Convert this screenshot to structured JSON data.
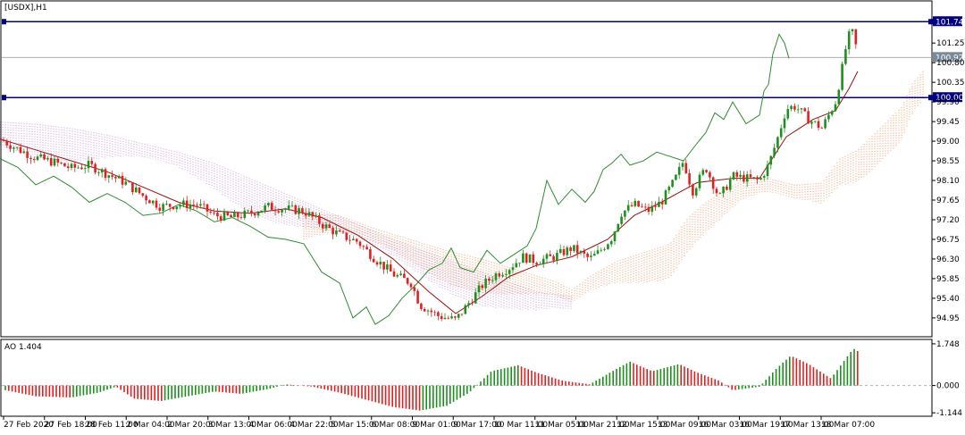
{
  "window_title": "[USDX],H1",
  "indicator_label": "AO 1.404",
  "colors": {
    "bull": "#1e8f1e",
    "bear": "#e02020",
    "ma": "#9a1010",
    "chikou": "#2e8b2e",
    "cloud_bull": "#f0a070",
    "cloud_bear": "#c8a0d8",
    "hline": "#000080",
    "price_tag": "#7a8a99"
  },
  "chart_data": [
    {
      "type": "candlestick",
      "title": "[USDX],H1",
      "ylim": [
        94.62,
        101.95
      ],
      "y_ticks": [
        "101.25",
        "100.80",
        "100.35",
        "99.90",
        "99.45",
        "99.00",
        "98.55",
        "98.10",
        "97.65",
        "97.20",
        "96.75",
        "96.30",
        "95.85",
        "95.40",
        "94.95"
      ],
      "x_ticks": [
        "27 Feb 2020",
        "27 Feb 18:00",
        "28 Feb 11:00",
        "2 Mar 04:00",
        "2 Mar 20:00",
        "3 Mar 13:00",
        "4 Mar 06:00",
        "4 Mar 22:00",
        "5 Mar 15:00",
        "6 Mar 08:00",
        "9 Mar 01:00",
        "9 Mar 17:00",
        "10 Mar 11:00",
        "11 Mar 05:00",
        "11 Mar 21:00",
        "12 Mar 15:00",
        "13 Mar 09:00",
        "16 Mar 03:00",
        "16 Mar 19:00",
        "17 Mar 13:00",
        "18 Mar 07:00"
      ],
      "horizontal_lines": [
        {
          "label": "101.74",
          "value": 101.74
        },
        {
          "label": "100.00",
          "value": 100.0
        }
      ],
      "current_price": {
        "label": "100.92",
        "value": 100.92
      },
      "close_path": [
        [
          0,
          99.05
        ],
        [
          20,
          98.82
        ],
        [
          40,
          98.62
        ],
        [
          60,
          98.52
        ],
        [
          80,
          98.38
        ],
        [
          100,
          98.45
        ],
        [
          120,
          98.25
        ],
        [
          140,
          98.05
        ],
        [
          160,
          97.75
        ],
        [
          180,
          97.5
        ],
        [
          200,
          97.55
        ],
        [
          220,
          97.55
        ],
        [
          240,
          97.3
        ],
        [
          260,
          97.25
        ],
        [
          280,
          97.35
        ],
        [
          300,
          97.5
        ],
        [
          320,
          97.45
        ],
        [
          340,
          97.4
        ],
        [
          360,
          97.1
        ],
        [
          380,
          96.85
        ],
        [
          400,
          96.7
        ],
        [
          420,
          96.3
        ],
        [
          440,
          95.95
        ],
        [
          460,
          95.75
        ],
        [
          470,
          95.25
        ],
        [
          490,
          95.0
        ],
        [
          510,
          94.9
        ],
        [
          525,
          95.3
        ],
        [
          540,
          95.7
        ],
        [
          555,
          95.95
        ],
        [
          570,
          96.1
        ],
        [
          585,
          96.35
        ],
        [
          600,
          96.25
        ],
        [
          620,
          96.35
        ],
        [
          640,
          96.55
        ],
        [
          660,
          96.3
        ],
        [
          670,
          96.45
        ],
        [
          685,
          96.8
        ],
        [
          695,
          97.35
        ],
        [
          710,
          97.55
        ],
        [
          725,
          97.4
        ],
        [
          740,
          97.6
        ],
        [
          755,
          98.1
        ],
        [
          765,
          98.55
        ],
        [
          775,
          97.85
        ],
        [
          790,
          98.4
        ],
        [
          805,
          97.7
        ],
        [
          820,
          98.2
        ],
        [
          835,
          98.15
        ],
        [
          850,
          98.1
        ],
        [
          860,
          98.45
        ],
        [
          870,
          99.05
        ],
        [
          880,
          99.75
        ],
        [
          890,
          99.8
        ],
        [
          905,
          99.5
        ],
        [
          920,
          99.3
        ],
        [
          935,
          99.9
        ],
        [
          942,
          100.6
        ],
        [
          948,
          101.3
        ],
        [
          953,
          101.55
        ],
        [
          957,
          101.25
        ],
        [
          961,
          100.92
        ]
      ],
      "ma_path": [
        [
          0,
          99.05
        ],
        [
          40,
          98.8
        ],
        [
          80,
          98.55
        ],
        [
          120,
          98.3
        ],
        [
          160,
          97.95
        ],
        [
          200,
          97.6
        ],
        [
          240,
          97.4
        ],
        [
          280,
          97.35
        ],
        [
          320,
          97.45
        ],
        [
          360,
          97.25
        ],
        [
          400,
          96.85
        ],
        [
          440,
          96.3
        ],
        [
          480,
          95.55
        ],
        [
          510,
          95.05
        ],
        [
          540,
          95.45
        ],
        [
          570,
          95.9
        ],
        [
          600,
          96.15
        ],
        [
          640,
          96.35
        ],
        [
          680,
          96.75
        ],
        [
          710,
          97.3
        ],
        [
          740,
          97.6
        ],
        [
          780,
          98.05
        ],
        [
          820,
          98.15
        ],
        [
          850,
          98.15
        ],
        [
          880,
          99.1
        ],
        [
          910,
          99.5
        ],
        [
          935,
          99.7
        ],
        [
          950,
          100.2
        ],
        [
          960,
          100.6
        ]
      ],
      "chikou_path": [
        [
          0,
          98.6
        ],
        [
          20,
          98.4
        ],
        [
          40,
          98.0
        ],
        [
          60,
          98.2
        ],
        [
          80,
          97.95
        ],
        [
          100,
          97.6
        ],
        [
          120,
          97.8
        ],
        [
          140,
          97.6
        ],
        [
          160,
          97.3
        ],
        [
          180,
          97.35
        ],
        [
          200,
          97.55
        ],
        [
          220,
          97.4
        ],
        [
          240,
          97.15
        ],
        [
          260,
          97.25
        ],
        [
          280,
          97.05
        ],
        [
          300,
          96.8
        ],
        [
          320,
          96.75
        ],
        [
          340,
          96.65
        ],
        [
          360,
          96.0
        ],
        [
          380,
          95.75
        ],
        [
          395,
          94.95
        ],
        [
          410,
          95.2
        ],
        [
          420,
          94.8
        ],
        [
          435,
          95.0
        ],
        [
          450,
          95.4
        ],
        [
          465,
          95.7
        ],
        [
          480,
          96.05
        ],
        [
          495,
          96.2
        ],
        [
          505,
          96.55
        ],
        [
          515,
          96.1
        ],
        [
          530,
          96.0
        ],
        [
          545,
          96.5
        ],
        [
          560,
          96.2
        ],
        [
          575,
          96.4
        ],
        [
          590,
          96.6
        ],
        [
          600,
          97.0
        ],
        [
          612,
          98.1
        ],
        [
          625,
          97.55
        ],
        [
          640,
          97.9
        ],
        [
          655,
          97.6
        ],
        [
          665,
          97.85
        ],
        [
          675,
          98.35
        ],
        [
          685,
          98.5
        ],
        [
          695,
          98.7
        ],
        [
          705,
          98.45
        ],
        [
          720,
          98.55
        ],
        [
          735,
          98.75
        ],
        [
          750,
          98.65
        ],
        [
          765,
          98.55
        ],
        [
          780,
          98.95
        ],
        [
          790,
          99.2
        ],
        [
          800,
          99.65
        ],
        [
          810,
          99.5
        ],
        [
          820,
          99.9
        ],
        [
          835,
          99.4
        ],
        [
          850,
          99.6
        ],
        [
          855,
          100.15
        ],
        [
          860,
          100.3
        ],
        [
          865,
          101.0
        ],
        [
          872,
          101.45
        ],
        [
          878,
          101.25
        ],
        [
          883,
          100.9
        ]
      ],
      "cloud_bear_path": [
        [
          0,
          99.45
        ],
        [
          40,
          99.4
        ],
        [
          80,
          99.3
        ],
        [
          120,
          99.15
        ],
        [
          160,
          98.95
        ],
        [
          200,
          98.75
        ],
        [
          240,
          98.5
        ],
        [
          280,
          98.15
        ],
        [
          320,
          97.8
        ],
        [
          360,
          97.45
        ],
        [
          400,
          97.1
        ],
        [
          440,
          96.75
        ],
        [
          480,
          96.45
        ],
        [
          520,
          96.15
        ],
        [
          560,
          95.85
        ],
        [
          600,
          95.55
        ],
        [
          640,
          95.45
        ]
      ],
      "cloud_bull_path": [
        [
          340,
          97.35
        ],
        [
          380,
          97.3
        ],
        [
          420,
          97.0
        ],
        [
          460,
          96.75
        ],
        [
          500,
          96.5
        ],
        [
          540,
          96.3
        ],
        [
          580,
          96.05
        ],
        [
          620,
          95.8
        ],
        [
          640,
          95.6
        ],
        [
          660,
          95.9
        ],
        [
          690,
          96.25
        ],
        [
          720,
          96.45
        ],
        [
          750,
          96.65
        ],
        [
          770,
          97.25
        ],
        [
          790,
          97.6
        ],
        [
          810,
          97.85
        ],
        [
          830,
          98.1
        ],
        [
          860,
          98.15
        ],
        [
          890,
          98.0
        ],
        [
          920,
          98.05
        ],
        [
          940,
          98.6
        ],
        [
          960,
          98.8
        ],
        [
          990,
          99.4
        ],
        [
          1010,
          99.8
        ],
        [
          1020,
          100.3
        ],
        [
          1035,
          100.65
        ]
      ]
    },
    {
      "type": "histogram",
      "title": "AO 1.404",
      "ylim": [
        -1.25,
        1.82
      ],
      "y_ticks": [
        "1.748",
        "0.000",
        "-1.144"
      ],
      "bar_x_start": 6,
      "bar_x_end": 962,
      "bar_step": 3.8,
      "ao_path": [
        [
          0,
          -0.15
        ],
        [
          40,
          -0.45
        ],
        [
          80,
          -0.5
        ],
        [
          110,
          -0.3
        ],
        [
          130,
          -0.05
        ],
        [
          150,
          -0.55
        ],
        [
          180,
          -0.65
        ],
        [
          210,
          -0.45
        ],
        [
          240,
          -0.25
        ],
        [
          270,
          -0.35
        ],
        [
          300,
          -0.15
        ],
        [
          320,
          0.05
        ],
        [
          350,
          -0.05
        ],
        [
          380,
          -0.3
        ],
        [
          410,
          -0.6
        ],
        [
          440,
          -0.9
        ],
        [
          470,
          -1.05
        ],
        [
          500,
          -0.85
        ],
        [
          525,
          -0.3
        ],
        [
          550,
          0.6
        ],
        [
          580,
          0.85
        ],
        [
          600,
          0.55
        ],
        [
          630,
          0.2
        ],
        [
          660,
          0.05
        ],
        [
          690,
          0.7
        ],
        [
          705,
          1.0
        ],
        [
          730,
          0.6
        ],
        [
          760,
          0.9
        ],
        [
          780,
          0.55
        ],
        [
          805,
          0.2
        ],
        [
          820,
          -0.2
        ],
        [
          850,
          -0.05
        ],
        [
          870,
          0.75
        ],
        [
          885,
          1.25
        ],
        [
          905,
          0.9
        ],
        [
          930,
          0.3
        ],
        [
          948,
          1.2
        ],
        [
          955,
          1.55
        ],
        [
          962,
          1.4
        ]
      ]
    }
  ]
}
